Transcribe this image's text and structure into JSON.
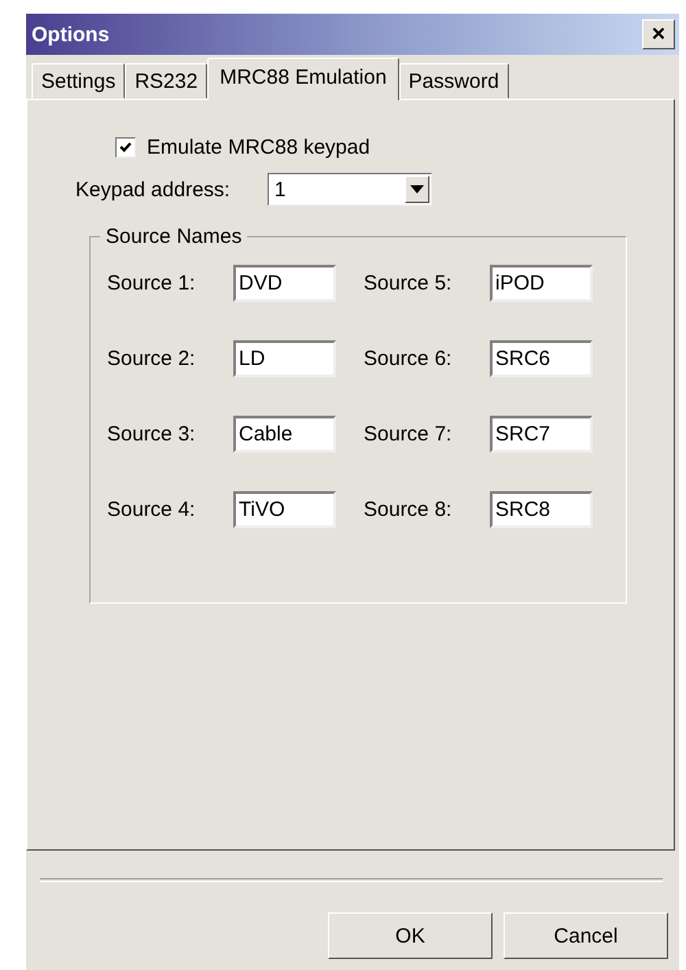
{
  "window": {
    "title": "Options",
    "close_label": "×"
  },
  "tabs": [
    {
      "label": "Settings",
      "selected": false
    },
    {
      "label": "RS232",
      "selected": false
    },
    {
      "label": "MRC88 Emulation",
      "selected": true
    },
    {
      "label": "Password",
      "selected": false
    }
  ],
  "emulate_checkbox": {
    "label": "Emulate MRC88 keypad",
    "checked": true
  },
  "keypad_address": {
    "label": "Keypad address:",
    "value": "1"
  },
  "source_names": {
    "title": "Source Names",
    "sources": [
      {
        "label": "Source 1:",
        "value": "DVD"
      },
      {
        "label": "Source 2:",
        "value": "LD"
      },
      {
        "label": "Source 3:",
        "value": "Cable"
      },
      {
        "label": "Source 4:",
        "value": "TiVO"
      },
      {
        "label": "Source 5:",
        "value": "iPOD"
      },
      {
        "label": "Source 6:",
        "value": "SRC6"
      },
      {
        "label": "Source 7:",
        "value": "SRC7"
      },
      {
        "label": "Source 8:",
        "value": "SRC8"
      }
    ]
  },
  "buttons": [
    "OK",
    "Cancel"
  ]
}
